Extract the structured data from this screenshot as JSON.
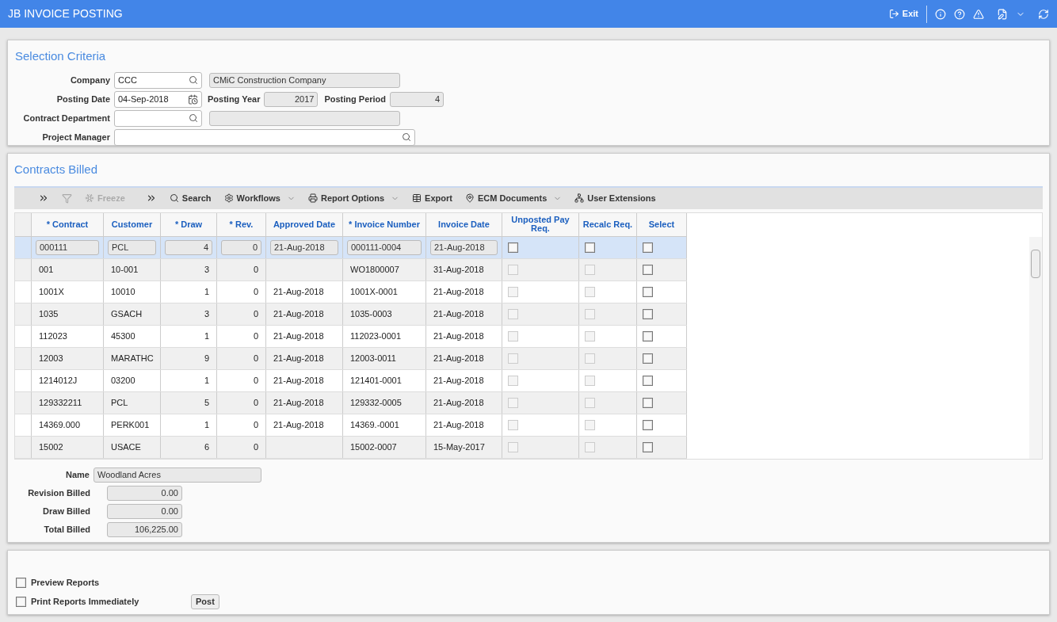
{
  "title_bar": {
    "title": "JB INVOICE POSTING",
    "exit_label": "Exit"
  },
  "selection_criteria": {
    "heading": "Selection Criteria",
    "company": {
      "label": "Company",
      "value": "CCC",
      "name": "CMiC Construction Company"
    },
    "posting_date": {
      "label": "Posting Date",
      "value": "04-Sep-2018"
    },
    "posting_year": {
      "label": "Posting Year",
      "value": "2017"
    },
    "posting_period": {
      "label": "Posting Period",
      "value": "4"
    },
    "contract_department": {
      "label": "Contract Department"
    },
    "project_manager": {
      "label": "Project Manager"
    }
  },
  "contracts_billed": {
    "heading": "Contracts Billed",
    "toolbar": [
      {
        "kind": "expand"
      },
      {
        "kind": "filter",
        "disabled": true
      },
      {
        "kind": "freeze",
        "label": "Freeze",
        "disabled": true
      },
      {
        "kind": "expand"
      },
      {
        "kind": "search",
        "label": "Search",
        "disabled": false
      },
      {
        "kind": "workflows",
        "label": "Workflows",
        "disabled": false,
        "has_menu": true
      },
      {
        "kind": "print",
        "label": "Report Options",
        "disabled": false,
        "has_menu": true
      },
      {
        "kind": "export",
        "label": "Export",
        "disabled": false
      },
      {
        "kind": "documents",
        "label": "ECM Documents",
        "disabled": false,
        "has_menu": true
      },
      {
        "kind": "extensions",
        "label": "User Extensions",
        "disabled": false
      }
    ],
    "columns": [
      "* Contract",
      "Customer",
      "* Draw",
      "* Rev.",
      "Approved Date",
      "* Invoice Number",
      "Invoice Date",
      "Unposted Pay Req.",
      "Recalc Req.",
      "Select"
    ],
    "rows": [
      {
        "selected": true,
        "contract": "000111",
        "customer": "PCL",
        "draw": "4",
        "rev": "0",
        "approved_date": "21-Aug-2018",
        "invoice_number": "000111-0004",
        "invoice_date": "21-Aug-2018",
        "unposted": false,
        "recalc": false,
        "select": false
      },
      {
        "selected": false,
        "contract": "001",
        "customer": "10-001",
        "draw": "3",
        "rev": "0",
        "approved_date": "",
        "invoice_number": "WO1800007",
        "invoice_date": "31-Aug-2018",
        "unposted": false,
        "recalc": false,
        "select": false
      },
      {
        "selected": false,
        "contract": "1001X",
        "customer": "10010",
        "draw": "1",
        "rev": "0",
        "approved_date": "21-Aug-2018",
        "invoice_number": "1001X-0001",
        "invoice_date": "21-Aug-2018",
        "unposted": false,
        "recalc": false,
        "select": false
      },
      {
        "selected": false,
        "contract": "1035",
        "customer": "GSACH",
        "draw": "3",
        "rev": "0",
        "approved_date": "21-Aug-2018",
        "invoice_number": "1035-0003",
        "invoice_date": "21-Aug-2018",
        "unposted": false,
        "recalc": false,
        "select": false
      },
      {
        "selected": false,
        "contract": "112023",
        "customer": "45300",
        "draw": "1",
        "rev": "0",
        "approved_date": "21-Aug-2018",
        "invoice_number": "112023-0001",
        "invoice_date": "21-Aug-2018",
        "unposted": false,
        "recalc": false,
        "select": false
      },
      {
        "selected": false,
        "contract": "12003",
        "customer": "MARATHC",
        "draw": "9",
        "rev": "0",
        "approved_date": "21-Aug-2018",
        "invoice_number": "12003-0011",
        "invoice_date": "21-Aug-2018",
        "unposted": false,
        "recalc": false,
        "select": false
      },
      {
        "selected": false,
        "contract": "1214012J",
        "customer": "03200",
        "draw": "1",
        "rev": "0",
        "approved_date": "21-Aug-2018",
        "invoice_number": "121401-0001",
        "invoice_date": "21-Aug-2018",
        "unposted": false,
        "recalc": false,
        "select": false
      },
      {
        "selected": false,
        "contract": "129332211",
        "customer": "PCL",
        "draw": "5",
        "rev": "0",
        "approved_date": "21-Aug-2018",
        "invoice_number": "129332-0005",
        "invoice_date": "21-Aug-2018",
        "unposted": false,
        "recalc": false,
        "select": false
      },
      {
        "selected": false,
        "contract": "14369.000",
        "customer": "PERK001",
        "draw": "1",
        "rev": "0",
        "approved_date": "21-Aug-2018",
        "invoice_number": "14369.-0001",
        "invoice_date": "21-Aug-2018",
        "unposted": false,
        "recalc": false,
        "select": false
      },
      {
        "selected": false,
        "contract": "15002",
        "customer": "USACE",
        "draw": "6",
        "rev": "0",
        "approved_date": "",
        "invoice_number": "15002-0007",
        "invoice_date": "15-May-2017",
        "unposted": false,
        "recalc": false,
        "select": false
      }
    ],
    "summary": [
      {
        "label": "Name",
        "value": "Woodland Acres",
        "kind": "text"
      },
      {
        "label": "Revision Billed",
        "value": "0.00",
        "kind": "amount"
      },
      {
        "label": "Draw Billed",
        "value": "0.00",
        "kind": "amount"
      },
      {
        "label": "Total Billed",
        "value": "106,225.00",
        "kind": "amount"
      }
    ]
  },
  "options": [
    {
      "label": "Preview Reports",
      "checked": false
    },
    {
      "label": "Print Reports Immediately",
      "checked": false
    }
  ],
  "post_button": "Post"
}
